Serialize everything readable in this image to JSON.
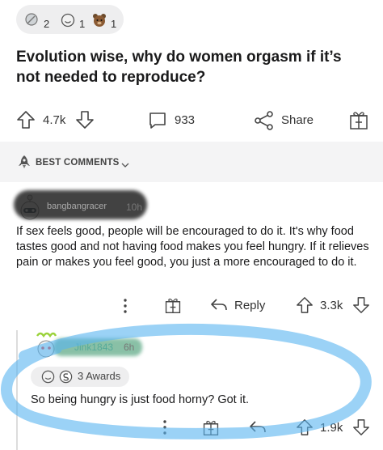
{
  "post": {
    "awards": [
      {
        "icon": "award-silver-icon",
        "count": "2"
      },
      {
        "icon": "award-smile-icon",
        "count": "1"
      },
      {
        "icon": "award-bear-icon",
        "count": "1"
      }
    ],
    "title": "Evolution wise, why do women orgasm if it’s not needed to reproduce?",
    "actions": {
      "votes": "4.7k",
      "comments": "933",
      "share_label": "Share"
    }
  },
  "sort": {
    "label": "BEST COMMENTS"
  },
  "comments": [
    {
      "username": "bangbangracer",
      "time": "10h",
      "body": "If sex feels good, people will be encouraged to do it.  It's why food tastes good and not having food makes you feel hungry.  If it relieves pain or makes you feel good, you just a more encouraged to do it.",
      "actions": {
        "reply_label": "Reply",
        "votes": "3.3k"
      }
    },
    {
      "username": "Jink1843",
      "time": "6h",
      "awards_label": "3 Awards",
      "body": "So being hungry is just food horny?  Got it.",
      "actions": {
        "votes": "1.9k"
      }
    }
  ],
  "colors": {
    "annotation_stroke": "#58b4f0",
    "band": "#f4f4f5",
    "text": "#1a1a1b"
  }
}
